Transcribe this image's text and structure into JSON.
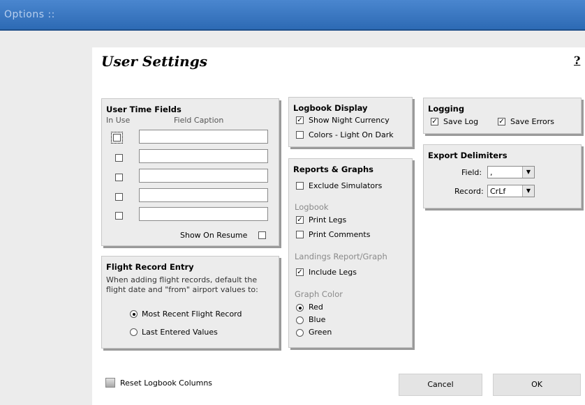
{
  "window": {
    "title": "Options ::"
  },
  "page": {
    "title": "User Settings",
    "help_glyph": "?"
  },
  "user_time_fields": {
    "title": "User Time Fields",
    "col_in_use": "In Use",
    "col_caption": "Field Caption",
    "rows": [
      {
        "in_use": false,
        "caption": ""
      },
      {
        "in_use": false,
        "caption": ""
      },
      {
        "in_use": false,
        "caption": ""
      },
      {
        "in_use": false,
        "caption": ""
      },
      {
        "in_use": false,
        "caption": ""
      }
    ],
    "show_on_resume_label": "Show On Resume",
    "show_on_resume_checked": false
  },
  "flight_record_entry": {
    "title": "Flight Record Entry",
    "desc_line1": "When adding flight records, default the",
    "desc_line2": "flight date and \"from\" airport values to:",
    "options": [
      "Most Recent Flight Record",
      "Last Entered Values"
    ],
    "selected": "Most Recent Flight Record"
  },
  "logbook_display": {
    "title": "Logbook Display",
    "show_night_currency": {
      "label": "Show Night Currency",
      "checked": true
    },
    "colors_light_on_dark": {
      "label": "Colors - Light On Dark",
      "checked": false
    }
  },
  "reports_graphs": {
    "title": "Reports & Graphs",
    "exclude_simulators": {
      "label": "Exclude Simulators",
      "checked": false
    },
    "logbook_heading": "Logbook",
    "print_legs": {
      "label": "Print Legs",
      "checked": true
    },
    "print_comments": {
      "label": "Print Comments",
      "checked": false
    },
    "landings_heading": "Landings Report/Graph",
    "include_legs": {
      "label": "Include Legs",
      "checked": true
    },
    "graph_color_heading": "Graph Color",
    "graph_colors": [
      "Red",
      "Blue",
      "Green"
    ],
    "graph_color_selected": "Red"
  },
  "logging": {
    "title": "Logging",
    "save_log": {
      "label": "Save Log",
      "checked": true
    },
    "save_errors": {
      "label": "Save Errors",
      "checked": true
    }
  },
  "export_delimiters": {
    "title": "Export Delimiters",
    "field_label": "Field:",
    "field_value": ",",
    "record_label": "Record:",
    "record_value": "CrLf"
  },
  "footer": {
    "reset_label": "Reset Logbook Columns",
    "cancel_label": "Cancel",
    "ok_label": "OK"
  },
  "colors": {
    "titlebar": "#2d6ab4",
    "panel": "#ececec",
    "heading_gray": "#8a8a8a"
  }
}
